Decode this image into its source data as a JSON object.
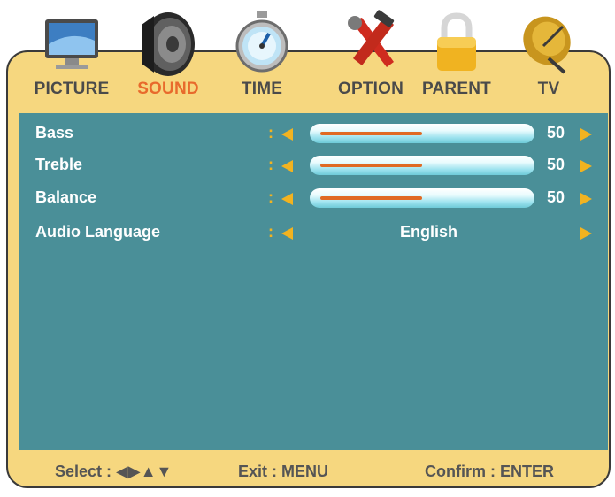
{
  "tabs": [
    {
      "label": "PICTURE",
      "icon": "tv-icon",
      "active": false
    },
    {
      "label": "SOUND",
      "icon": "speaker-icon",
      "active": true
    },
    {
      "label": "TIME",
      "icon": "stopwatch-icon",
      "active": false
    },
    {
      "label": "OPTION",
      "icon": "tools-icon",
      "active": false
    },
    {
      "label": "PARENT",
      "icon": "lock-icon",
      "active": false
    },
    {
      "label": "TV",
      "icon": "satellite-dish-icon",
      "active": false
    }
  ],
  "menu": {
    "rows": [
      {
        "label": "Bass",
        "colon": ":",
        "value": "50",
        "level": 50
      },
      {
        "label": "Treble",
        "colon": ":",
        "value": "50",
        "level": 50
      },
      {
        "label": "Balance",
        "colon": ":",
        "value": "50",
        "level": 50
      },
      {
        "label": "Audio Language",
        "colon": ":",
        "value": "English"
      }
    ]
  },
  "footer": {
    "select_label": "Select :",
    "select_glyphs": "◀▶▲▼",
    "exit": "Exit : MENU",
    "confirm": "Confirm : ENTER"
  },
  "colors": {
    "frame": "#f6d77f",
    "panel": "#4a8f98",
    "accent": "#e86a2c",
    "arrow": "#f2b320"
  }
}
